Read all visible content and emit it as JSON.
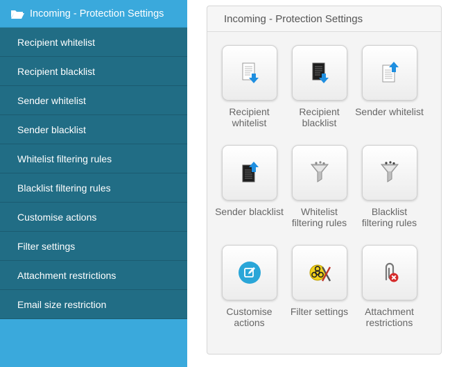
{
  "sidebar": {
    "header": "Incoming - Protection Settings",
    "items": [
      {
        "label": "Recipient whitelist"
      },
      {
        "label": "Recipient blacklist"
      },
      {
        "label": "Sender whitelist"
      },
      {
        "label": "Sender blacklist"
      },
      {
        "label": "Whitelist filtering rules"
      },
      {
        "label": "Blacklist filtering rules"
      },
      {
        "label": "Customise actions"
      },
      {
        "label": "Filter settings"
      },
      {
        "label": "Attachment restrictions"
      },
      {
        "label": "Email size restriction"
      }
    ]
  },
  "panel": {
    "title": "Incoming - Protection Settings",
    "tiles": [
      {
        "lines": [
          "Recipient",
          "whitelist"
        ],
        "icon": "whitelist-document-download-icon"
      },
      {
        "lines": [
          "Recipient",
          "blacklist"
        ],
        "icon": "blacklist-document-download-icon"
      },
      {
        "lines": [
          "Sender whitelist"
        ],
        "icon": "whitelist-document-upload-icon"
      },
      {
        "lines": [
          "Sender blacklist"
        ],
        "icon": "blacklist-document-upload-icon"
      },
      {
        "lines": [
          "Whitelist",
          "filtering rules"
        ],
        "icon": "funnel-icon"
      },
      {
        "lines": [
          "Blacklist",
          "filtering rules"
        ],
        "icon": "funnel-icon"
      },
      {
        "lines": [
          "Customise",
          "actions"
        ],
        "icon": "edit-circle-icon"
      },
      {
        "lines": [
          "Filter settings"
        ],
        "icon": "biohazard-tools-icon"
      },
      {
        "lines": [
          "Attachment",
          "restrictions"
        ],
        "icon": "paperclip-blocked-icon"
      }
    ]
  },
  "colors": {
    "sidebar_header": "#3aa9dc",
    "sidebar_item": "#216d85",
    "accent_blue": "#1f8fe0",
    "edit_circle": "#2aa6d8",
    "block_red": "#d52b2b"
  }
}
